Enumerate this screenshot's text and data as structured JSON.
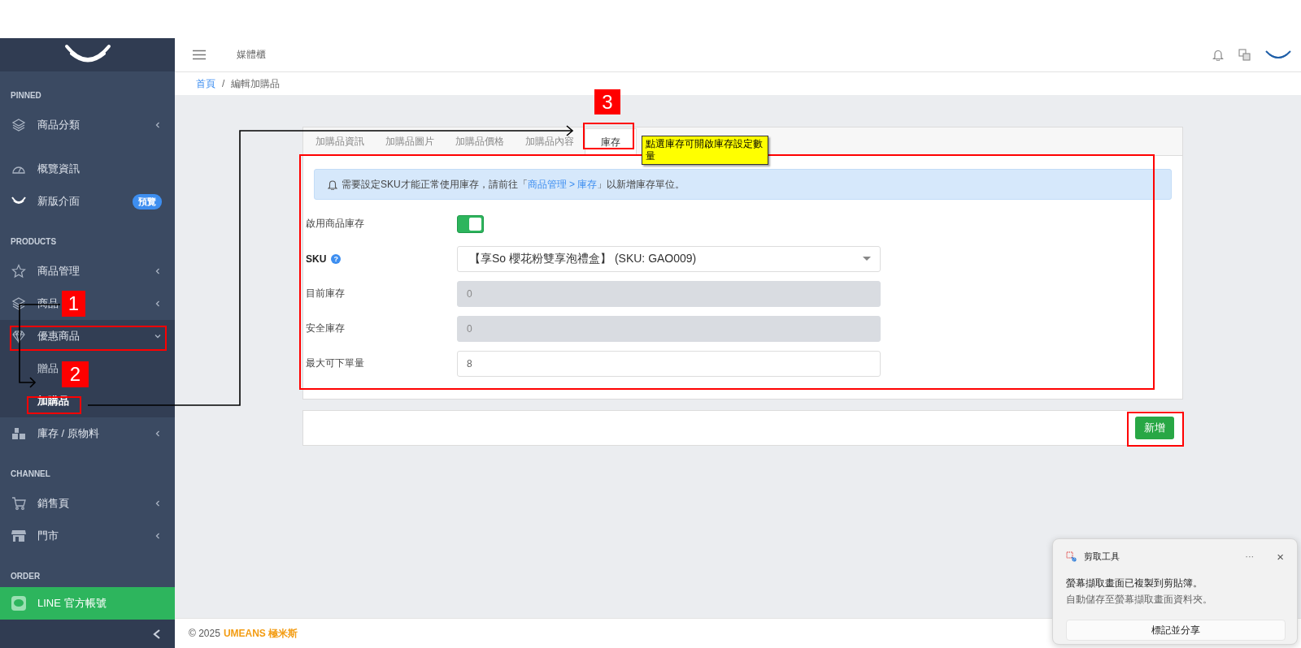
{
  "sidebar": {
    "sections": [
      {
        "title": "PINNED",
        "items": [
          {
            "label": "商品分類",
            "expanded": false
          }
        ]
      },
      {
        "items": [
          {
            "label": "概覽資訊"
          },
          {
            "label": "新版介面",
            "badge": "預覽"
          }
        ]
      },
      {
        "title": "PRODUCTS",
        "items": [
          {
            "label": "商品管理",
            "expanded": false
          },
          {
            "label": "商品",
            "expanded": false
          },
          {
            "label": "優惠商品",
            "expanded": true,
            "children": [
              {
                "label": "贈品",
                "selected": false
              },
              {
                "label": "加購品",
                "selected": true
              }
            ]
          },
          {
            "label": "庫存 / 原物料",
            "expanded": false
          }
        ]
      },
      {
        "title": "CHANNEL",
        "items": [
          {
            "label": "銷售頁",
            "expanded": false
          },
          {
            "label": "門市",
            "expanded": false
          }
        ]
      },
      {
        "title": "ORDER"
      }
    ],
    "footer_item": {
      "label": "LINE 官方帳號",
      "color": "#2db55d"
    }
  },
  "topbar": {
    "title": "媒體櫃"
  },
  "breadcrumb": {
    "items": [
      "首頁",
      "編輯加購品"
    ],
    "separator": "/"
  },
  "tabs": [
    {
      "label": "加購品資訊",
      "selected": false
    },
    {
      "label": "加購品圖片",
      "selected": false
    },
    {
      "label": "加購品價格",
      "selected": false
    },
    {
      "label": "加購品內容",
      "selected": false
    },
    {
      "label": "庫存",
      "selected": true
    }
  ],
  "alert": {
    "before": "需要設定SKU才能正常使用庫存，請前往「",
    "link": "商品管理 > 庫存",
    "after": "」以新增庫存單位。"
  },
  "form": [
    {
      "kind": "toggle",
      "label": "啟用商品庫存",
      "on": true
    },
    {
      "kind": "select",
      "label": "SKU",
      "help": "?",
      "value": "【享So 櫻花粉雙享泡禮盒】 (SKU: GAO009)"
    },
    {
      "kind": "input",
      "label": "目前庫存",
      "value": "0",
      "disabled": true
    },
    {
      "kind": "input",
      "label": "安全庫存",
      "value": "0",
      "disabled": true
    },
    {
      "kind": "input",
      "label": "最大可下單量",
      "value": "8",
      "disabled": false
    }
  ],
  "actions": {
    "submit": "新增"
  },
  "footer": {
    "copyright": "© 2025",
    "brand": "UMEANS 極米斯"
  },
  "toast": {
    "app": "剪取工具",
    "more": "···",
    "close": "×",
    "message": "螢幕擷取畫面已複製到剪貼簿。",
    "detail": "自動儲存至螢幕擷取畫面資料夾。",
    "button": "標記並分享"
  },
  "annotations": {
    "markers": [
      "1",
      "2",
      "3"
    ],
    "callout": "點選庫存可開啟庫存設定數量"
  }
}
